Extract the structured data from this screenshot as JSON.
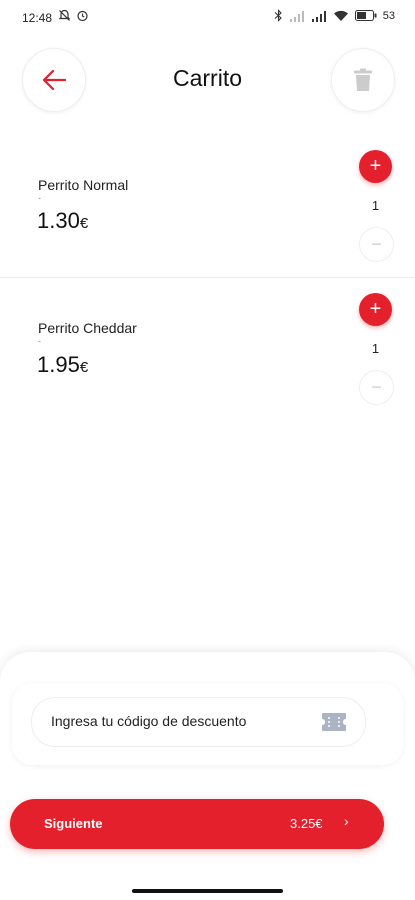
{
  "status_bar": {
    "time": "12:48",
    "battery": "53"
  },
  "header": {
    "title": "Carrito"
  },
  "cart": {
    "items": [
      {
        "name": "Perrito Normal",
        "dash": "-",
        "price": "1.30",
        "currency": "€",
        "qty": "1",
        "plus": "+",
        "minus": "−"
      },
      {
        "name": "Perrito Cheddar",
        "dash": "-",
        "price": "1.95",
        "currency": "€",
        "qty": "1",
        "plus": "+",
        "minus": "−"
      }
    ]
  },
  "discount": {
    "placeholder": "Ingresa tu código de descuento"
  },
  "next_button": {
    "label": "Siguiente",
    "total": "3.25€",
    "chevron": "›"
  },
  "colors": {
    "accent": "#e3202b",
    "disabled": "#cccccc"
  },
  "icons": {
    "back": "arrow-left-icon",
    "trash": "trash-icon",
    "ticket": "ticket-icon"
  }
}
